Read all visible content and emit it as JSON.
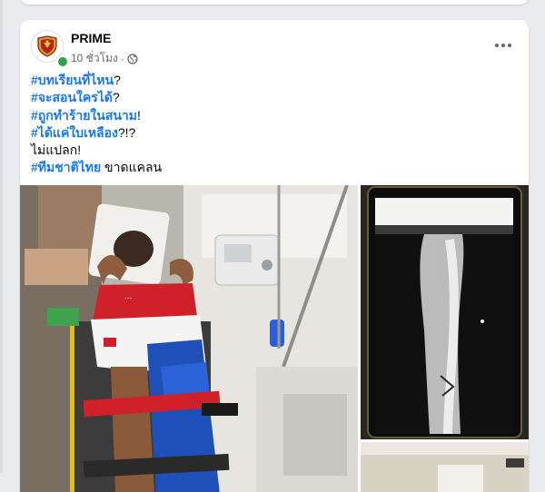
{
  "post": {
    "author": "PRIME",
    "time": "10 ชั่วโมง",
    "separator": "·",
    "privacy_icon": "globe-icon",
    "more_icon": "more-options-icon",
    "status": "online",
    "lines": [
      {
        "tag": "#บทเรียนที่ไหน",
        "rest": "?"
      },
      {
        "tag": "#จะสอนใครได้",
        "rest": "?"
      },
      {
        "tag": "#ถูกทำร้ายในสนาม",
        "rest": "!"
      },
      {
        "tag": "#ได้แค่ใบเหลือง",
        "rest": "?!?"
      },
      {
        "tag": "",
        "rest": "ไม่แปลก!"
      },
      {
        "tag": "#ทีมชาติไทย",
        "rest": " ขาดแคลน"
      }
    ],
    "xray_label": "",
    "photos": [
      "injured-player-stretcher-photo",
      "leg-xray-phone-photo",
      "partial-photo"
    ]
  },
  "colors": {
    "hashtag": "#1877f2",
    "text": "#050505",
    "secondary": "#65676b",
    "online": "#31a24c",
    "background": "#e9ebee"
  }
}
